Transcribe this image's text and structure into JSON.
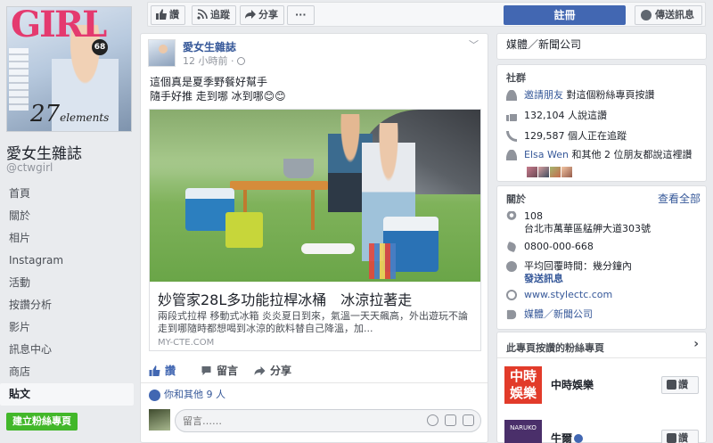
{
  "page": {
    "name": "愛女生雜誌",
    "handle": "@ctwgirl",
    "cover": {
      "brand": "GIRL",
      "issue": "68",
      "headline_number": "27",
      "headline_word": "elements"
    }
  },
  "nav": {
    "items": [
      "首頁",
      "關於",
      "相片",
      "Instagram",
      "活動",
      "按讚分析",
      "影片",
      "訊息中心",
      "商店",
      "貼文"
    ],
    "active_index": 9,
    "create_page_label": "建立粉絲專頁"
  },
  "topbar": {
    "like_label": "讚",
    "follow_label": "追蹤",
    "share_label": "分享",
    "more_label": "···",
    "signup_label": "註冊",
    "message_label": "傳送訊息"
  },
  "post": {
    "author": "愛女生雜誌",
    "time": "12 小時前 · ",
    "privacy_icon": "globe-icon",
    "text_lines": [
      "這個真是夏季野餐好幫手",
      "隨手好推 走到哪 冰到哪😊😊"
    ],
    "link": {
      "title": "妙管家28L多功能拉桿冰桶　冰涼拉著走",
      "description": "兩段式拉桿 移動式冰箱 炎炎夏日到來，氣溫一天天飆高，外出遊玩不論走到哪隨時都想喝到冰涼的飲料替自己降溫，加...",
      "domain": "MY-CTE.COM"
    },
    "actions": {
      "like": "讚",
      "comment": "留言",
      "share": "分享"
    },
    "likes_text": "你和其他 9 人",
    "comment_placeholder": "留言……"
  },
  "right": {
    "category": "媒體／新聞公司",
    "community": {
      "heading": "社群",
      "invite_link": "邀請朋友",
      "invite_rest": " 對這個粉絲專頁按讚",
      "likes": "132,104 人說這讚",
      "following": "129,587 個人正在追蹤",
      "friend_name": "Elsa Wen",
      "friend_rest": " 和其他 2 位朋友都說這裡讚"
    },
    "about": {
      "heading": "關於",
      "see_all": "查看全部",
      "address_line1": "108",
      "address_line2": "台北市萬華區艋舺大道303號",
      "phone": "0800-000-668",
      "response_time": "平均回覆時間：幾分鐘內",
      "send_message": "發送訊息",
      "website": "www.stylectc.com",
      "category": "媒體／新聞公司"
    },
    "liked_pages": {
      "heading": "此專頁按讚的粉絲專頁",
      "items": [
        {
          "name": "中時娛樂",
          "thumb_text": "中時娛樂",
          "like_label": "讚"
        },
        {
          "name": "牛爾",
          "thumb_text": "NARUKO",
          "like_label": "讚"
        }
      ]
    }
  },
  "colors": {
    "brand_blue": "#4267b2",
    "link_blue": "#365899",
    "green": "#42b72a",
    "background": "#e9ebee"
  }
}
